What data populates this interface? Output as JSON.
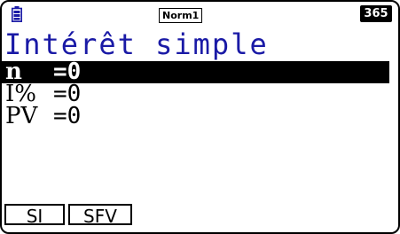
{
  "status_bar": {
    "battery_icon": "battery-icon",
    "mode_label": "Norm1",
    "counter": "365"
  },
  "screen": {
    "title": "Intérêt simple"
  },
  "variables": [
    {
      "name": "n",
      "eq_value": "=0",
      "selected": true
    },
    {
      "name": "I%",
      "eq_value": "=0",
      "selected": false
    },
    {
      "name": "PV",
      "eq_value": "=0",
      "selected": false
    }
  ],
  "function_keys": [
    {
      "label": "SI"
    },
    {
      "label": "SFV"
    }
  ],
  "colors": {
    "title": "#1a1aa6",
    "selection_bg": "#000000",
    "selection_fg": "#ffffff"
  }
}
